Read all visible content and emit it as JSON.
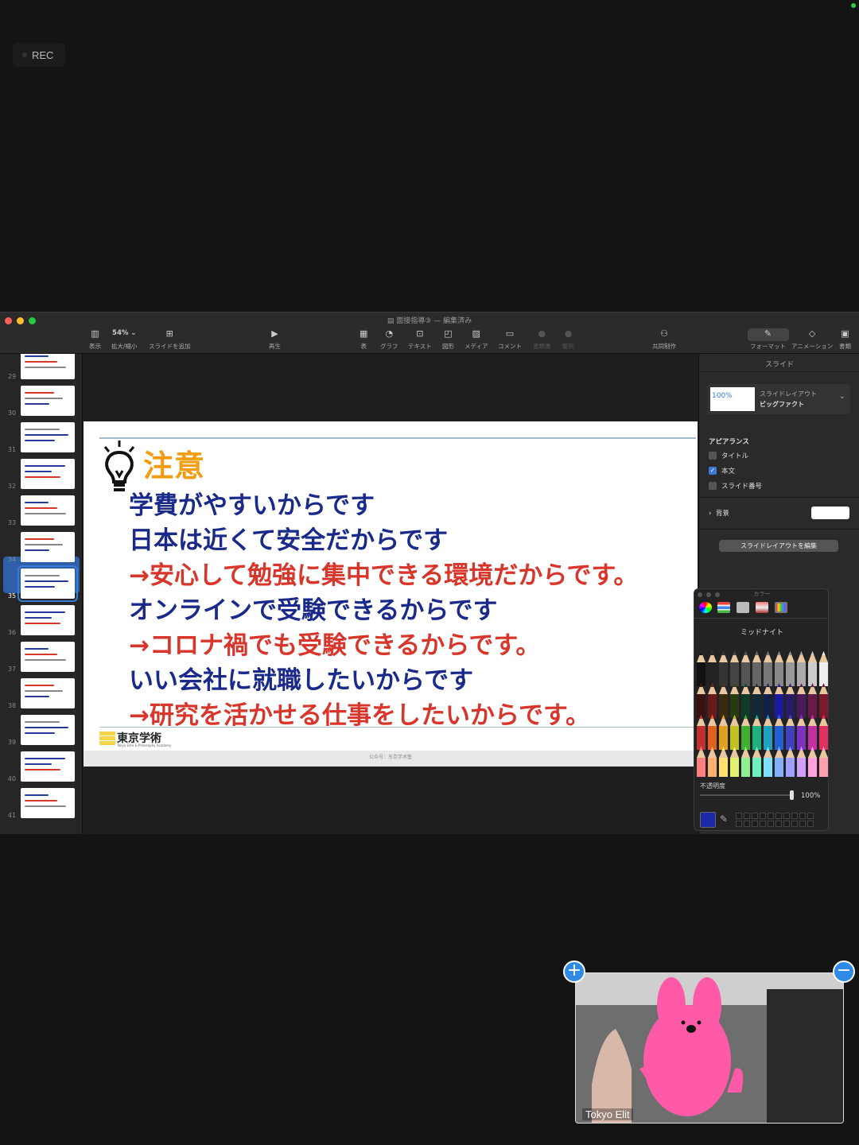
{
  "recording": {
    "label": "REC"
  },
  "window": {
    "title": "面接指導③ — 編集済み"
  },
  "toolbar": {
    "view": "表示",
    "zoom_value": "54%",
    "zoom_label": "拡大/縮小",
    "add_slide": "スライドを追加",
    "play": "再生",
    "table": "表",
    "chart": "グラフ",
    "text": "テキスト",
    "shape": "図形",
    "media": "メディア",
    "comment": "コメント",
    "dim1": "書類書",
    "dim2": "整列",
    "collaborate": "共同制作",
    "format": "フォーマット",
    "animate": "アニメーション",
    "document": "書類"
  },
  "sidebar": {
    "slide_numbers": [
      "29",
      "30",
      "31",
      "32",
      "33",
      "34",
      "35",
      "36",
      "37",
      "38",
      "39",
      "40",
      "41"
    ],
    "selected": "35"
  },
  "slide": {
    "heading": "注意",
    "lines": [
      {
        "text": "学費がやすいからです",
        "color": "navy"
      },
      {
        "text": "日本は近くて安全だからです",
        "color": "navy"
      },
      {
        "text": "→安心して勉強に集中できる環境だからです。",
        "color": "red"
      },
      {
        "text": "オンラインで受験できるからです",
        "color": "navy"
      },
      {
        "text": "→コロナ禍でも受験できるからです。",
        "color": "red"
      },
      {
        "text": "いい会社に就職したいからです",
        "color": "navy"
      },
      {
        "text": "→研究を活かせる仕事をしたいからです。",
        "color": "red"
      }
    ],
    "logo_text": "東京学術",
    "logo_sub": "Tokyo Elite & Philosophy Academy",
    "footer": "公众号：东京学术塾"
  },
  "inspector": {
    "tab": "スライド",
    "layout_thumb": "100%",
    "layout_label": "スライドレイアウト",
    "layout_name": "ビッグファクト",
    "appearance": "アピアランス",
    "opt_title": "タイトル",
    "opt_body": "本文",
    "opt_number": "スライド番号",
    "background": "背景",
    "edit_layout": "スライドレイアウトを編集"
  },
  "colors_panel": {
    "title": "カラー",
    "color_name": "ミッドナイト",
    "opacity_label": "不透明度",
    "opacity_value": "100%",
    "selected_color": "#1a2aa8"
  },
  "video": {
    "name": "Tokyo Elit"
  },
  "colors": {
    "navy": "#1a2a8a",
    "red": "#d9362b",
    "heading": "#f39c12",
    "accent": "#3a7bd5"
  }
}
